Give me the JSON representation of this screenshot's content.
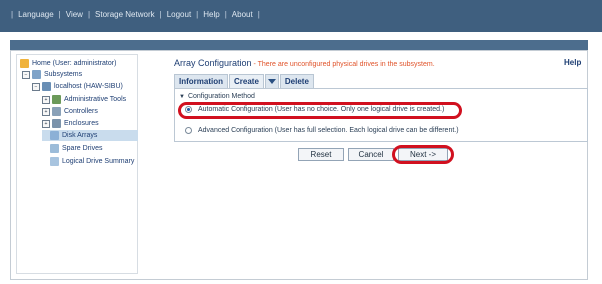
{
  "topbar": {
    "items": [
      "Language",
      "View",
      "Storage Network",
      "Logout",
      "Help",
      "About"
    ]
  },
  "tree": {
    "home_label": "Home (User: administrator)",
    "subsystems_label": "Subsystems",
    "host_label": "localhost (HAW-SIBU)",
    "admin_tools_label": "Administrative Tools",
    "controllers_label": "Controllers",
    "enclosures_label": "Enclosures",
    "disk_arrays_label": "Disk Arrays",
    "spare_drives_label": "Spare Drives",
    "ld_summary_label": "Logical Drive Summary"
  },
  "main": {
    "title": "Array Configuration",
    "warning": " - There are unconfigured physical drives in the subsystem.",
    "help_label": "Help",
    "tabs": {
      "information": "Information",
      "create": "Create",
      "delete": "Delete"
    },
    "section_label": "Configuration Method",
    "option_auto": "Automatic Configuration (User has no choice. Only one logical drive is created.)",
    "option_advanced": "Advanced Configuration (User has full selection. Each logical drive can be different.)",
    "selected_option": "automatic",
    "buttons": {
      "reset": "Reset",
      "cancel": "Cancel",
      "next": "Next ->"
    }
  },
  "colors": {
    "topbar": "#3f5f7f",
    "highlight": "#d1101f",
    "warning_text": "#e0532a",
    "selected_node": "#c9dced"
  }
}
